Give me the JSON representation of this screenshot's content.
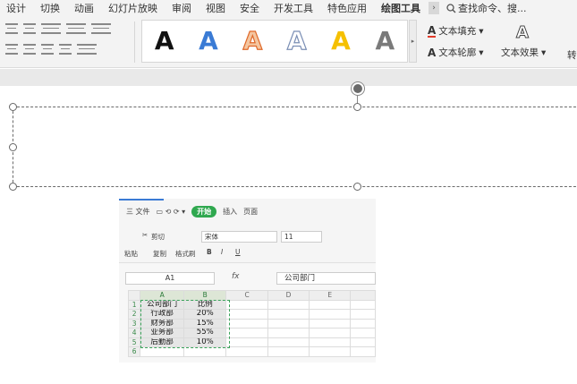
{
  "menu": {
    "items": [
      "设计",
      "切换",
      "动画",
      "幻灯片放映",
      "审阅",
      "视图",
      "安全",
      "开发工具",
      "特色应用",
      "绘图工具"
    ],
    "more": "›",
    "search": "查找命令、搜..."
  },
  "ribbon": {
    "art_styles": [
      "A",
      "A",
      "A",
      "A",
      "A",
      "A"
    ],
    "text_fill": "文本填充",
    "text_outline": "文本轮廓",
    "text_effect": "文本效果",
    "letter_a": "A",
    "truncated": "转"
  },
  "spreadsheet": {
    "toolbar": {
      "menu_file": "三 文件",
      "start": "开始",
      "insert": "插入",
      "page": "页面",
      "cut": "剪切",
      "paste": "粘贴",
      "copy": "复制",
      "format_painter": "格式刷",
      "font": "宋体",
      "size": "11",
      "bold": "B",
      "italic": "I",
      "underline": "U"
    },
    "namebox": "A1",
    "fx": "fx",
    "formula_value": "公司部门",
    "columns": [
      "A",
      "B",
      "C",
      "D",
      "E"
    ],
    "rows": [
      {
        "no": "1",
        "a": "公司部门",
        "b": "比例"
      },
      {
        "no": "2",
        "a": "行政部",
        "b": "20%"
      },
      {
        "no": "3",
        "a": "财务部",
        "b": "15%"
      },
      {
        "no": "4",
        "a": "业务部",
        "b": "55%"
      },
      {
        "no": "5",
        "a": "后勤部",
        "b": "10%"
      },
      {
        "no": "6",
        "a": "",
        "b": ""
      }
    ]
  }
}
